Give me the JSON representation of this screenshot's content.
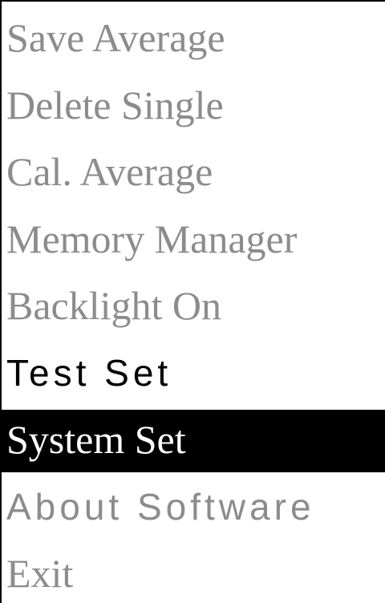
{
  "menu": {
    "items": [
      {
        "label": "Save Average"
      },
      {
        "label": "Delete Single"
      },
      {
        "label": "Cal. Average"
      },
      {
        "label": "Memory Manager"
      },
      {
        "label": "Backlight On"
      },
      {
        "label": "Test Set"
      },
      {
        "label": "System Set"
      },
      {
        "label": "About Software"
      },
      {
        "label": "Exit"
      }
    ],
    "selected_item": "System Set"
  },
  "colors": {
    "inactive_text": "#8c8c8c",
    "active_text": "#000000",
    "highlight_bg": "#000000",
    "highlight_text": "#ffffff",
    "background": "#ffffff"
  }
}
